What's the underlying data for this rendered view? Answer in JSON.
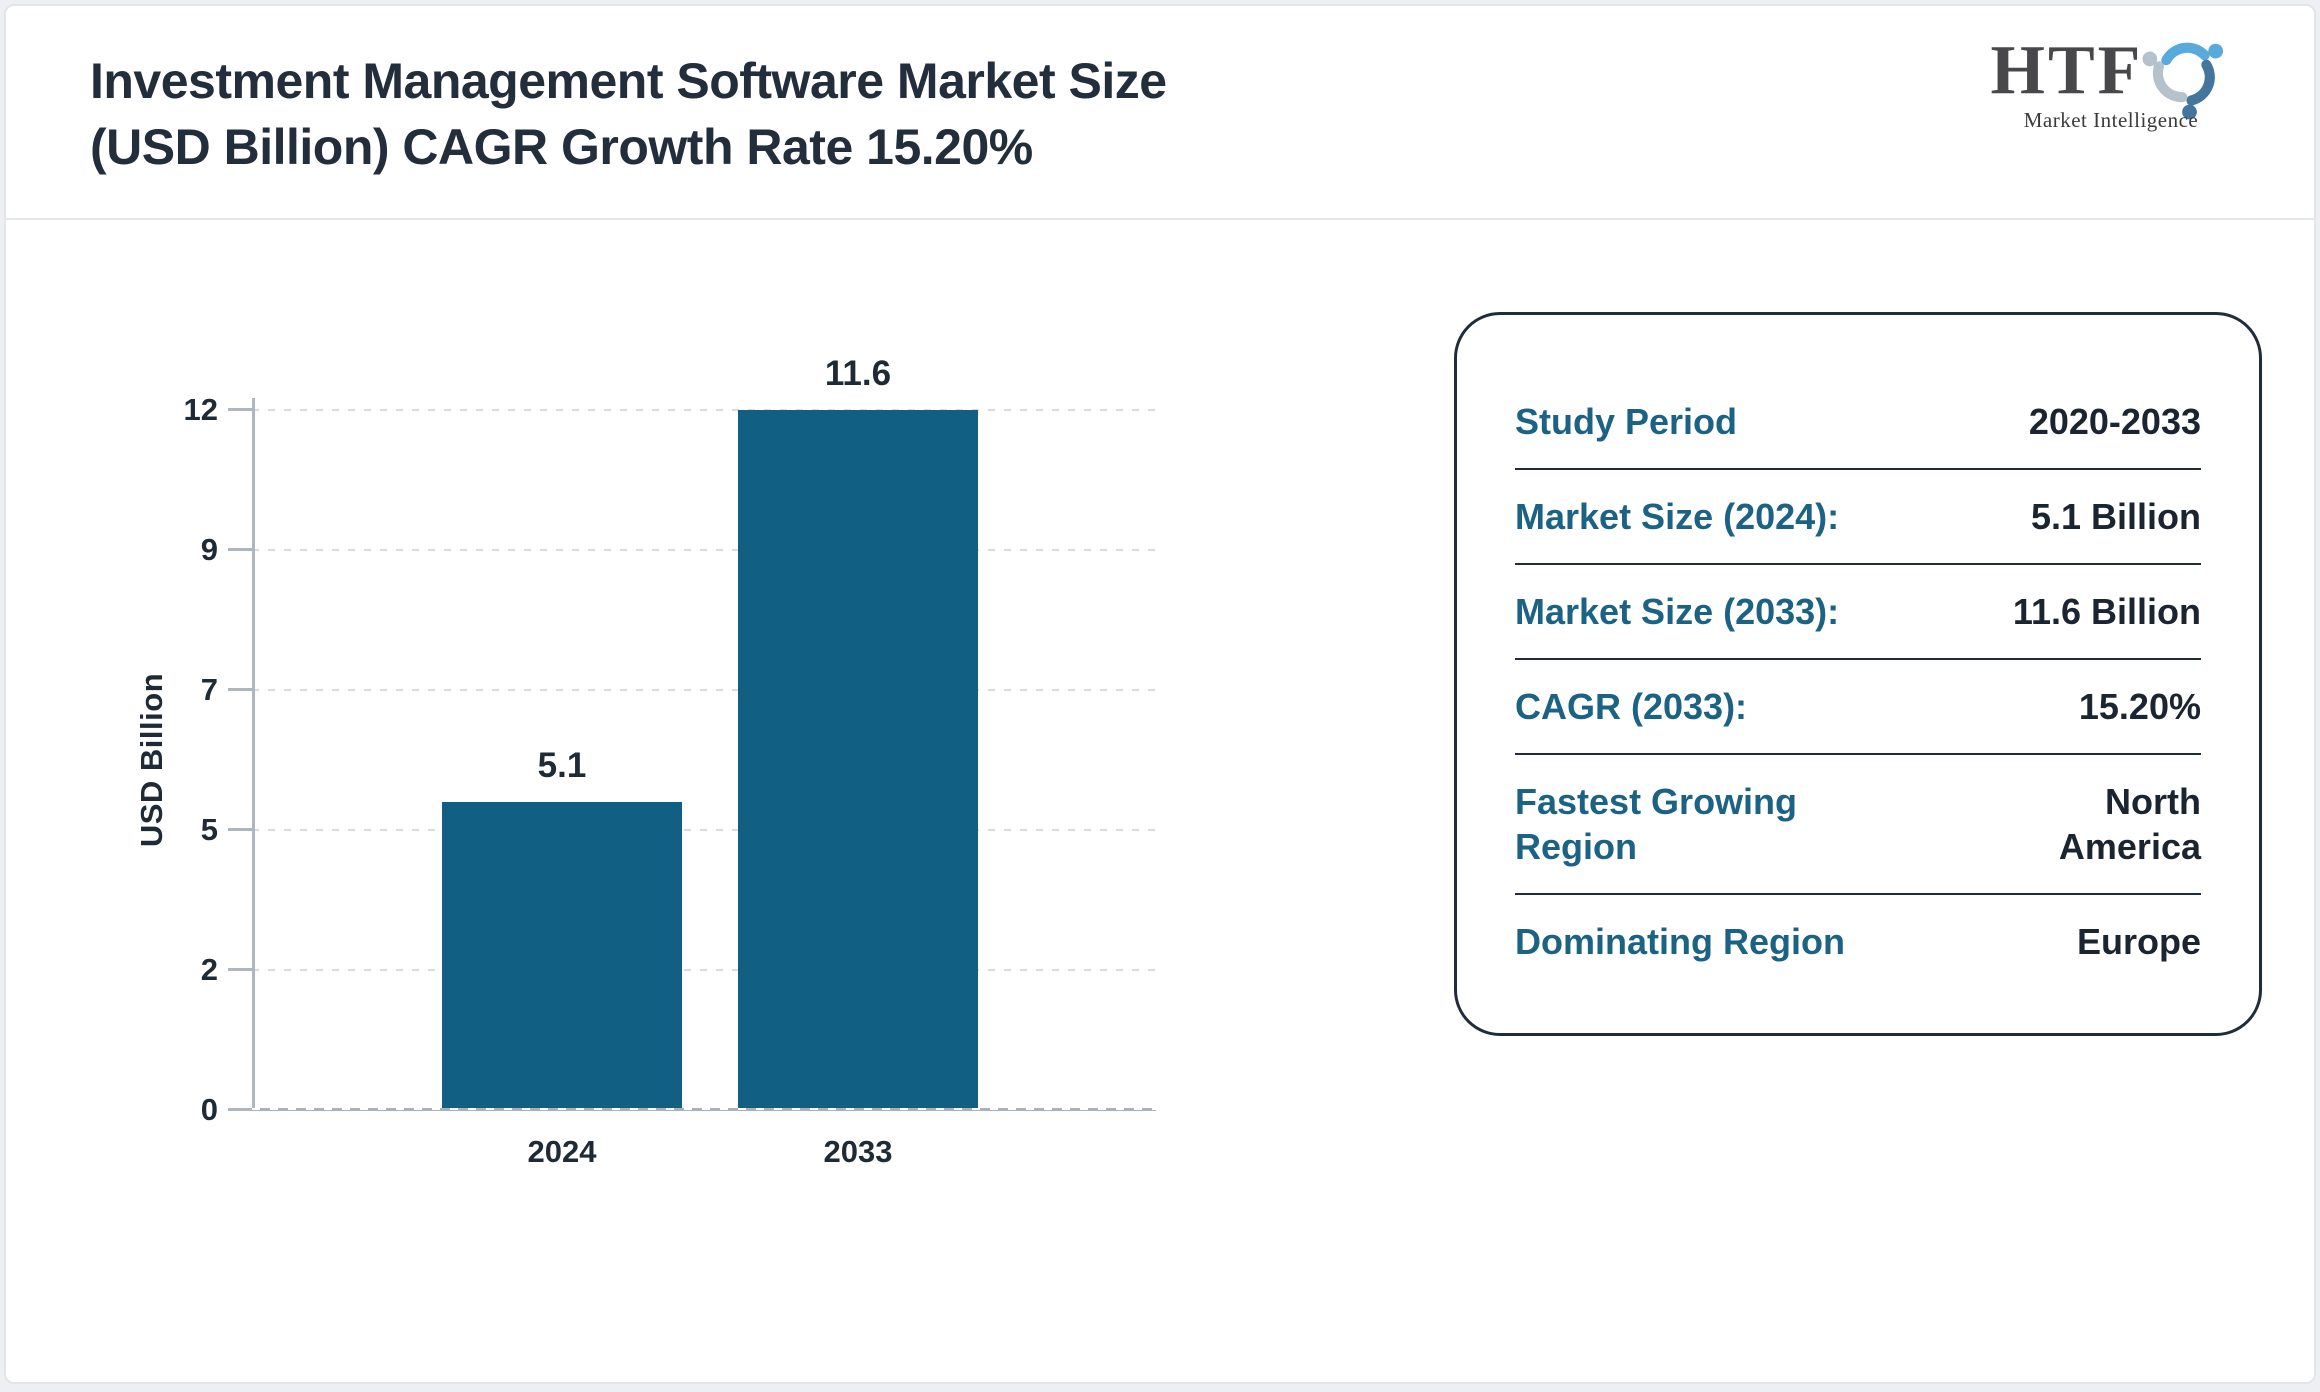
{
  "header": {
    "title_lines": [
      "Investment Management Software Market Size",
      "(USD Billion) CAGR Growth Rate 15.20%"
    ]
  },
  "logo": {
    "text": "HTF",
    "subtext": "Market Intelligence",
    "icon": "people-swirl-icon",
    "colors": {
      "light_blue": "#57aadb",
      "steel_blue": "#44759c",
      "gray_blue": "#b5c1cb",
      "text_gray": "#48484b"
    }
  },
  "chart_data": {
    "type": "bar",
    "title": "Investment Management Software Market Size (USD Billion) CAGR Growth Rate 15.20%",
    "categories": [
      "2024",
      "2033"
    ],
    "values": [
      5.1,
      11.6
    ],
    "value_labels": [
      "5.1",
      "11.6"
    ],
    "xlabel": "",
    "ylabel": "USD Billion",
    "ylim": [
      0,
      11.6
    ],
    "tick_labels_bottom_up": [
      "0",
      "2",
      "5",
      "7",
      "9",
      "12"
    ],
    "grid": "horizontal-dashed",
    "legend": "none",
    "bar_color": "#115f82"
  },
  "panel": {
    "rows": [
      {
        "label": "Study Period",
        "value": "2020-2033"
      },
      {
        "label": "Market Size (2024):",
        "value": "5.1 Billion"
      },
      {
        "label": "Market Size (2033):",
        "value": "11.6 Billion"
      },
      {
        "label": "CAGR (2033):",
        "value": "15.20%"
      },
      {
        "label": "Fastest Growing Region",
        "value": "North America"
      },
      {
        "label": "Dominating Region",
        "value": "Europe"
      }
    ]
  },
  "colors": {
    "page_bg": "#edeff2",
    "card_bg": "#ffffff",
    "card_border": "#e3e5ea",
    "header_divider": "#e4e6ec",
    "bar": "#115f82",
    "axis": "#aeb6c0",
    "gridline": "#d9dbdf",
    "dark_text": "#1f2a37",
    "panel_label_teal": "#1b6284",
    "panel_value_dark": "#1b2531",
    "panel_border": "#212c3a"
  }
}
